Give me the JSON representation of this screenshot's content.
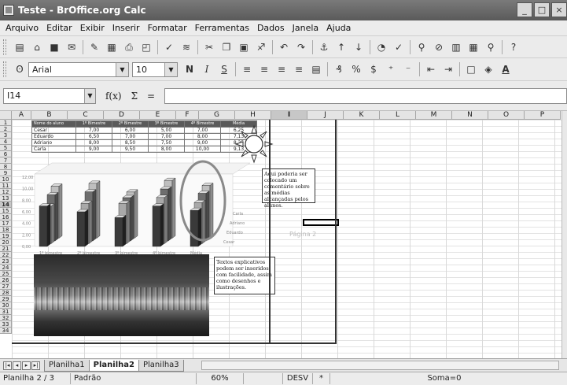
{
  "window": {
    "title": "Teste - BrOffice.org Calc",
    "buttons": [
      "_",
      "□",
      "×"
    ]
  },
  "menu": [
    "Arquivo",
    "Editar",
    "Exibir",
    "Inserir",
    "Formatar",
    "Ferramentas",
    "Dados",
    "Janela",
    "Ajuda"
  ],
  "toolbar2": {
    "font": "Arial",
    "size": "10",
    "bold": "N",
    "italic": "I",
    "underline": "S"
  },
  "formula": {
    "cell_ref": "I14",
    "fx": "f(x)",
    "sum": "Σ",
    "equals": "="
  },
  "columns": [
    "A",
    "B",
    "C",
    "D",
    "E",
    "F",
    "G",
    "H",
    "I",
    "J",
    "K",
    "L",
    "M",
    "N",
    "O",
    "P"
  ],
  "selected_column": "I",
  "rows": [
    "1",
    "2",
    "3",
    "4",
    "5",
    "6",
    "7",
    "8",
    "9",
    "10",
    "11",
    "12",
    "13",
    "14",
    "15",
    "16",
    "17",
    "18",
    "19",
    "20",
    "21",
    "22",
    "23",
    "24",
    "25",
    "26",
    "27",
    "28",
    "29",
    "30",
    "31",
    "32",
    "33",
    "34"
  ],
  "selected_row": "14",
  "table": {
    "header": [
      "Nome do aluno",
      "1º Bimestre",
      "2º Bimestre",
      "3º Bimestre",
      "4º Bimestre",
      "Média"
    ],
    "rows": [
      [
        "Cesar",
        "7,00",
        "6,00",
        "5,00",
        "7,00",
        "6,25"
      ],
      [
        "Eduardo",
        "6,50",
        "7,00",
        "7,00",
        "8,00",
        "7,13"
      ],
      [
        "Adriano",
        "8,00",
        "8,50",
        "7,50",
        "9,00",
        "8,25"
      ],
      [
        "Carla",
        "9,00",
        "9,50",
        "8,00",
        "10,00",
        "9,13"
      ]
    ]
  },
  "chart_data": {
    "type": "bar",
    "categories": [
      "1º bimestre",
      "2º bimestre",
      "3º bimestre",
      "4º bimestre",
      "Média"
    ],
    "series": [
      {
        "name": "Carla",
        "values": [
          9.0,
          9.5,
          8.0,
          10.0,
          9.13
        ]
      },
      {
        "name": "Adriano",
        "values": [
          8.0,
          8.5,
          7.5,
          9.0,
          8.25
        ]
      },
      {
        "name": "Eduardo",
        "values": [
          6.5,
          7.0,
          7.0,
          8.0,
          7.13
        ]
      },
      {
        "name": "Cesar",
        "values": [
          7.0,
          6.0,
          5.0,
          7.0,
          6.25
        ]
      }
    ],
    "ylim": [
      0,
      12
    ]
  },
  "callouts": {
    "comment1": "Aqui poderia ser colocado um comentário sobre as médias alcançadas pelos alunos.",
    "comment2": "Textos explicativos podem ser inseridos com facilidade, assim como desenhos e ilustrações."
  },
  "page_watermark": "Página 2",
  "sheets": [
    "Planilha1",
    "Planilha2",
    "Planilha3"
  ],
  "active_sheet": "Planilha2",
  "status": {
    "sheet": "Planilha 2 / 3",
    "style": "Padrão",
    "zoom": "60%",
    "mode": "DESV",
    "flag": "*",
    "sum": "Soma=0"
  }
}
